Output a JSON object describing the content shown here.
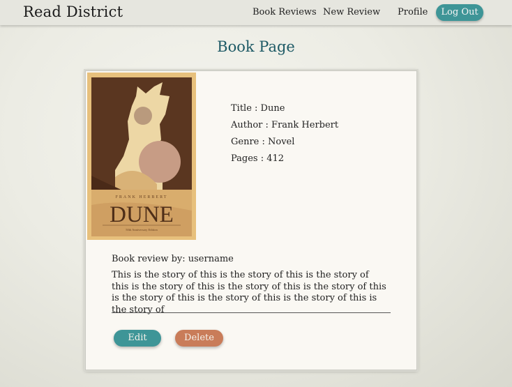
{
  "nav": {
    "brand": "Read District",
    "links": [
      "Book Reviews",
      "New Review",
      "Profile"
    ],
    "logout_label": "Log Out"
  },
  "page": {
    "title": "Book Page"
  },
  "book": {
    "cover": {
      "author_text": "FRANK HERBERT",
      "title_text": "DUNE",
      "edition_text": "50th Anniversary Edition"
    },
    "title_line": "Title : Dune",
    "author_line": "Author : Frank Herbert",
    "genre_line": "Genre : Novel",
    "pages_line": "Pages : 412"
  },
  "review": {
    "by_line": "Book review by: username",
    "text": "This is the story of this is the story of this is the story of this is the story of this is the story of this is the story of this is the story of this is the story of this is the story of this is the story of"
  },
  "actions": {
    "edit_label": "Edit",
    "delete_label": "Delete"
  },
  "colors": {
    "teal": "#3e9597",
    "terracotta": "#c97c59",
    "title_blue": "#1e5a66"
  }
}
